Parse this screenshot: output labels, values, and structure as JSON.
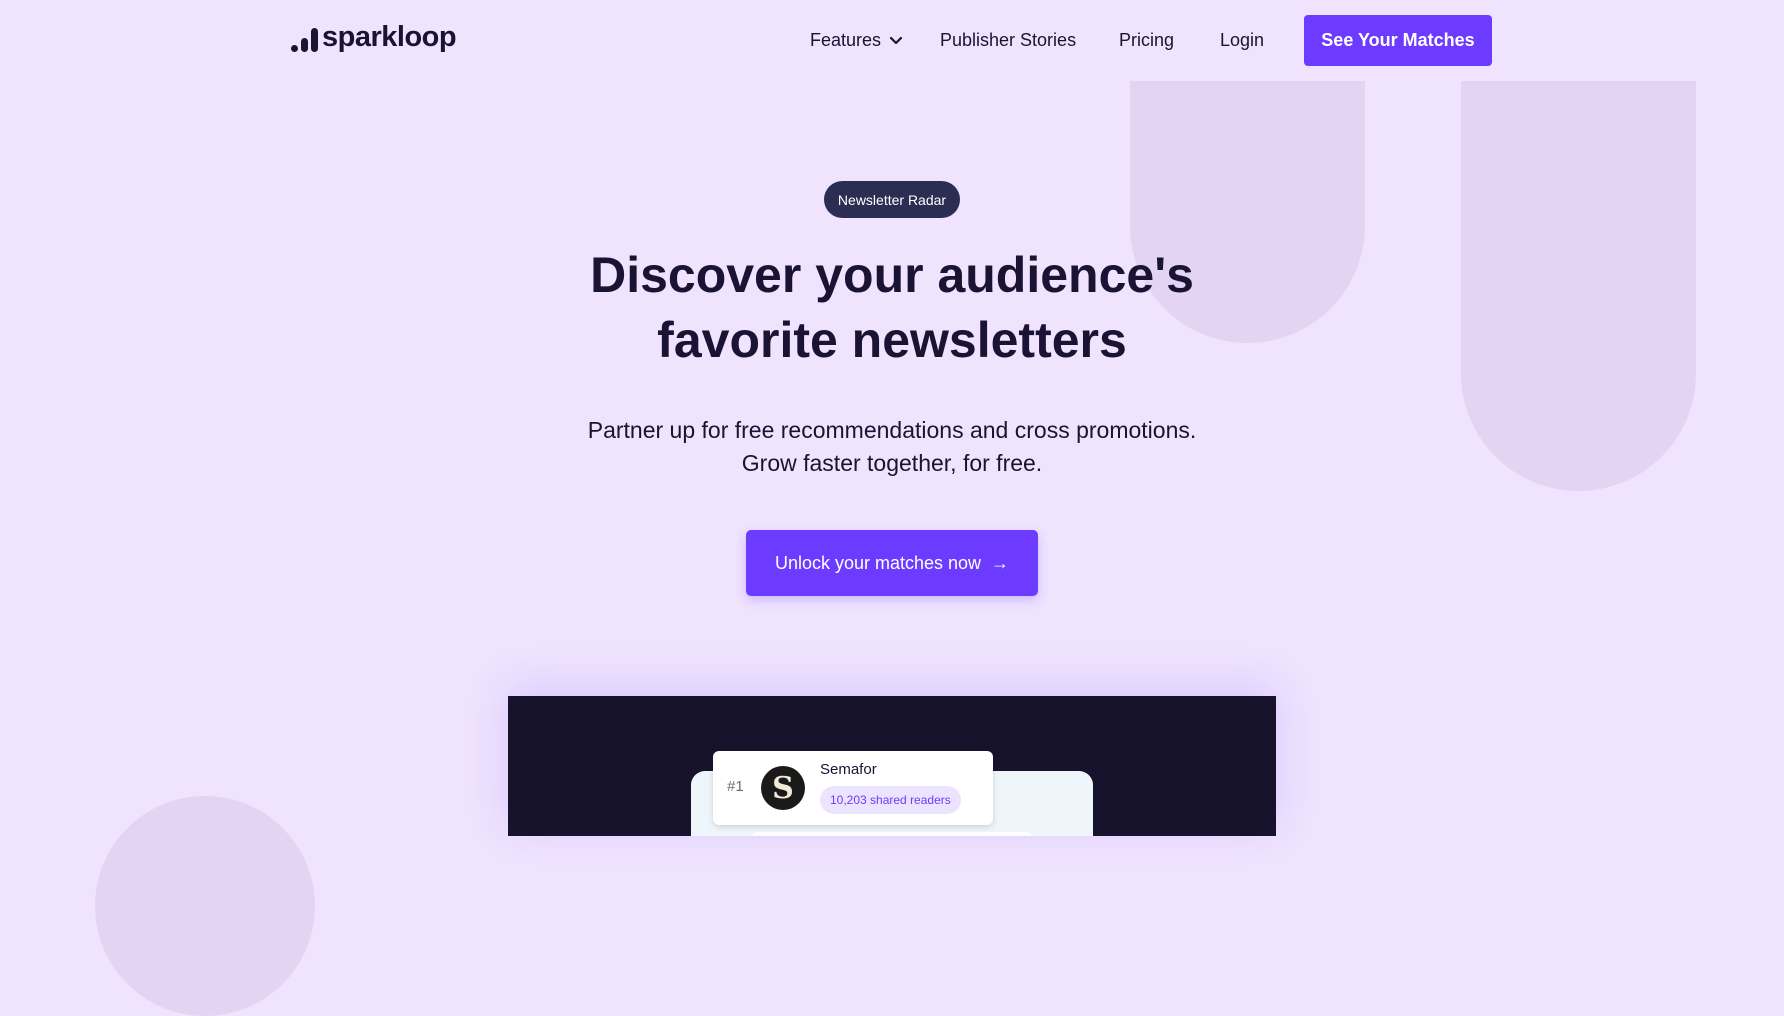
{
  "brand": {
    "name": "sparkloop"
  },
  "nav": {
    "features": "Features",
    "stories": "Publisher Stories",
    "pricing": "Pricing",
    "login": "Login",
    "cta": "See Your Matches"
  },
  "hero": {
    "badge": "Newsletter Radar",
    "headline_line1": "Discover your audience's",
    "headline_line2": "favorite newsletters",
    "sub_line1": "Partner up for free recommendations and cross promotions.",
    "sub_line2": "Grow faster together, for free.",
    "cta": "Unlock your matches now",
    "cta_icon": "→"
  },
  "preview": {
    "rank": "#1",
    "avatar_letter": "S",
    "name": "Semafor",
    "shared": "10,203 shared readers"
  },
  "colors": {
    "background": "#efe3fe",
    "accent": "#6c3bff",
    "badge": "#2c2d53",
    "dark_panel": "#17132d"
  }
}
